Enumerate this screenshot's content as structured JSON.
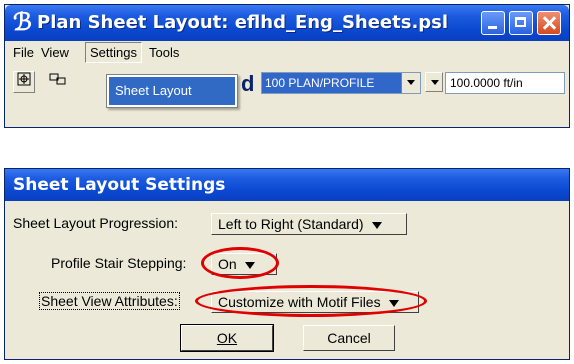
{
  "window1": {
    "title": "Plan Sheet Layout: eflhd_Eng_Sheets.psl",
    "menu": {
      "file": "File",
      "view": "View",
      "settings": "Settings",
      "tools": "Tools"
    },
    "popup_item": "Sheet Layout",
    "sheet_type": "100 PLAN/PROFILE",
    "scale": "100.0000 ft/in",
    "partial_tool_text": "d"
  },
  "window2": {
    "title": "Sheet Layout Settings",
    "progression_label": "Sheet Layout Progression:",
    "progression_value": "Left to Right (Standard)",
    "stair_label": "Profile Stair Stepping:",
    "stair_value": "On",
    "view_attr_label": "Sheet View Attributes:",
    "view_attr_value": "Customize with Motif Files",
    "ok_label": "OK",
    "cancel_label": "Cancel"
  },
  "colors": {
    "titlebar": "#0b48d0",
    "highlight_circle": "#e00000",
    "menu_highlight": "#316ac5"
  }
}
